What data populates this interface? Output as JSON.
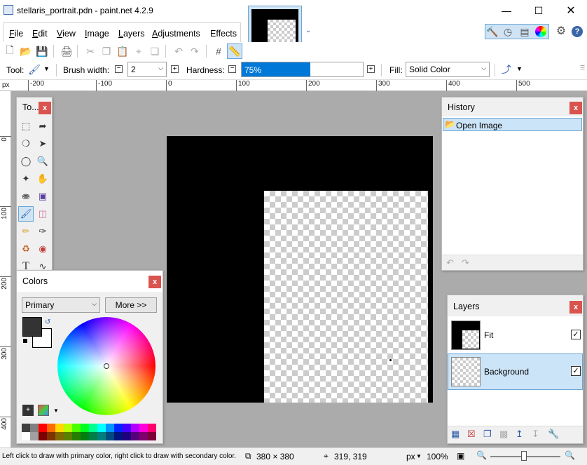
{
  "window": {
    "title": "stellaris_portrait.pdn - paint.net 4.2.9"
  },
  "menu": {
    "items": [
      {
        "label": "File",
        "key": "F",
        "rest": "ile"
      },
      {
        "label": "Edit",
        "key": "E",
        "rest": "dit"
      },
      {
        "label": "View",
        "key": "V",
        "rest": "iew"
      },
      {
        "label": "Image",
        "key": "I",
        "rest": "mage"
      },
      {
        "label": "Layers",
        "key": "L",
        "rest": "ayers"
      },
      {
        "label": "Adjustments",
        "key": "A",
        "rest": "djustments"
      },
      {
        "label": "Effects",
        "key": "",
        "rest": "Effects"
      }
    ]
  },
  "toolbar": {
    "tool_label": "Tool:",
    "brush_width_label": "Brush width:",
    "brush_width_value": "2",
    "hardness_label": "Hardness:",
    "hardness_value": "75%",
    "hardness_fraction": 0.75,
    "fill_label": "Fill:",
    "fill_value": "Solid Color"
  },
  "ruler": {
    "unit": "px",
    "h_labels": [
      "-200",
      "-100",
      "0",
      "100",
      "200",
      "300",
      "400",
      "500"
    ],
    "v_labels": [
      "0",
      "100",
      "200",
      "300",
      "400"
    ]
  },
  "tools_panel": {
    "title": "To..."
  },
  "colors_panel": {
    "title": "Colors",
    "mode": "Primary",
    "more_button": "More >>",
    "primary_color": "#333333",
    "secondary_color": "#ffffff",
    "palette_top": [
      "#404040",
      "#808080",
      "#ff0000",
      "#ff6a00",
      "#ffd800",
      "#b6ff00",
      "#4cff00",
      "#00ff21",
      "#00ff90",
      "#00ffff",
      "#0094ff",
      "#0026ff",
      "#4800ff",
      "#b200ff",
      "#ff00dc",
      "#ff006e"
    ],
    "palette_bottom": [
      "#ffffff",
      "#a0a0a0",
      "#7f0000",
      "#7f3300",
      "#7f6a00",
      "#5b7f00",
      "#267f00",
      "#007f0e",
      "#007f46",
      "#007f7f",
      "#004a7f",
      "#00137f",
      "#21007f",
      "#57007f",
      "#7f006e",
      "#7f0037"
    ]
  },
  "history_panel": {
    "title": "History",
    "items": [
      {
        "label": "Open Image"
      }
    ]
  },
  "layers_panel": {
    "title": "Layers",
    "layers": [
      {
        "name": "Fit",
        "visible": true,
        "selected": false
      },
      {
        "name": "Background",
        "visible": true,
        "selected": true
      }
    ]
  },
  "status": {
    "hint": "Left click to draw with primary color, right click to draw with secondary color.",
    "image_size": "380 × 380",
    "cursor_pos": "319, 319",
    "unit": "px",
    "zoom": "100%"
  },
  "colors": {
    "accent": "#0078d7",
    "selection": "#cce4f7",
    "close": "#d9534f"
  }
}
